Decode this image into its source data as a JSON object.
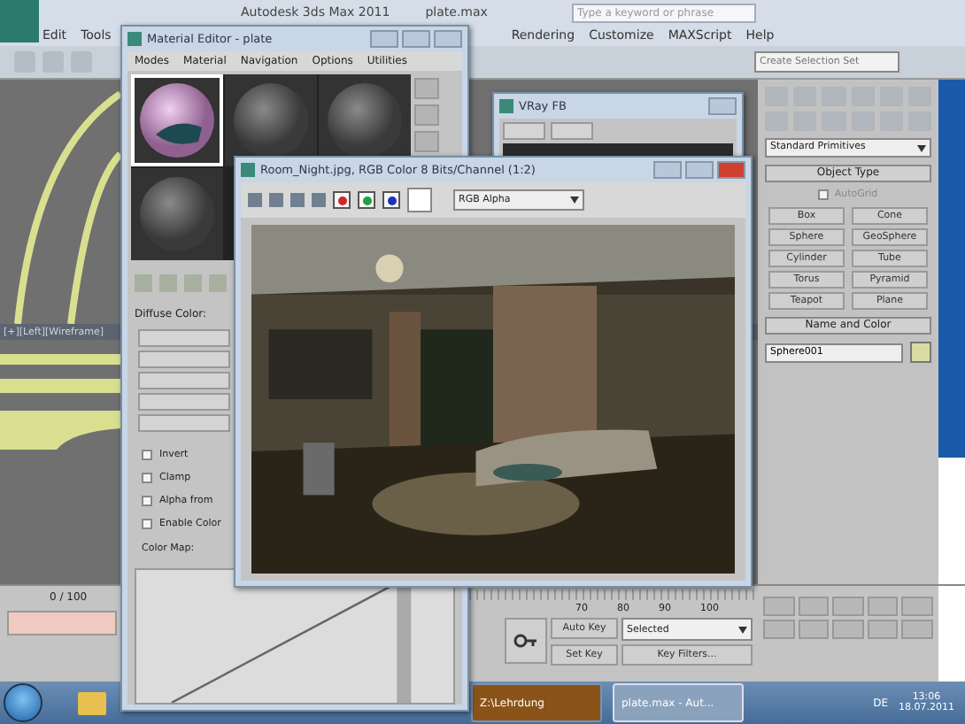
{
  "window": {
    "title": "Autodesk 3ds Max 2011",
    "file": "plate.max"
  },
  "search": {
    "placeholder": "Type a keyword or phrase"
  },
  "menu": [
    "Edit",
    "Tools",
    "Rendering",
    "Customize",
    "MAXScript",
    "Help"
  ],
  "selection_set": {
    "placeholder": "Create Selection Set"
  },
  "viewport": {
    "label": "[+][Left][Wireframe]"
  },
  "command_panel": {
    "category": "Standard Primitives",
    "object_type": "Object Type",
    "autogrid": {
      "label": "AutoGrid",
      "checked": false
    },
    "buttons": [
      "Box",
      "Cone",
      "Sphere",
      "GeoSphere",
      "Cylinder",
      "Tube",
      "Torus",
      "Pyramid",
      "Teapot",
      "Plane"
    ],
    "name_and_color": "Name and Color",
    "name": "Sphere001",
    "color": "#d8dca0"
  },
  "material_editor": {
    "title": "Material Editor - plate",
    "menu": [
      "Modes",
      "Material",
      "Navigation",
      "Options",
      "Utilities"
    ],
    "samples": [
      {
        "kind": "chrome",
        "selected": true
      },
      {
        "kind": "plain",
        "selected": false
      },
      {
        "kind": "plain",
        "selected": false
      },
      {
        "kind": "plain",
        "selected": false
      }
    ],
    "diffuse_label": "Diffuse Color:",
    "options": [
      {
        "label": "Invert",
        "checked": false
      },
      {
        "label": "Clamp",
        "checked": false
      },
      {
        "label": "Alpha from",
        "checked": false
      },
      {
        "label": "Enable Color",
        "checked": false
      }
    ],
    "color_map": "Color Map:"
  },
  "vray_fb": {
    "title": "VRay FB"
  },
  "image_window": {
    "title": "Room_Night.jpg, RGB Color 8 Bits/Channel (1:2)",
    "channels": [
      {
        "color": "#d02828",
        "on": true
      },
      {
        "color": "#20a040",
        "on": true
      },
      {
        "color": "#2030c0",
        "on": true
      }
    ],
    "channel_select": "RGB Alpha"
  },
  "timeline": {
    "frame": "0 / 100",
    "ticks": [
      "70",
      "80",
      "90",
      "100"
    ],
    "auto_key": "Auto Key",
    "set_key": "Set Key",
    "key_mode": "Selected",
    "key_filters": "Key Filters..."
  },
  "taskbar": {
    "items": [
      {
        "label": "Z:\\Lehrdung",
        "selected": false
      },
      {
        "label": "plate.max - Aut...",
        "selected": true
      }
    ],
    "language": "DE",
    "time": "13:06",
    "date": "18.07.2011"
  }
}
